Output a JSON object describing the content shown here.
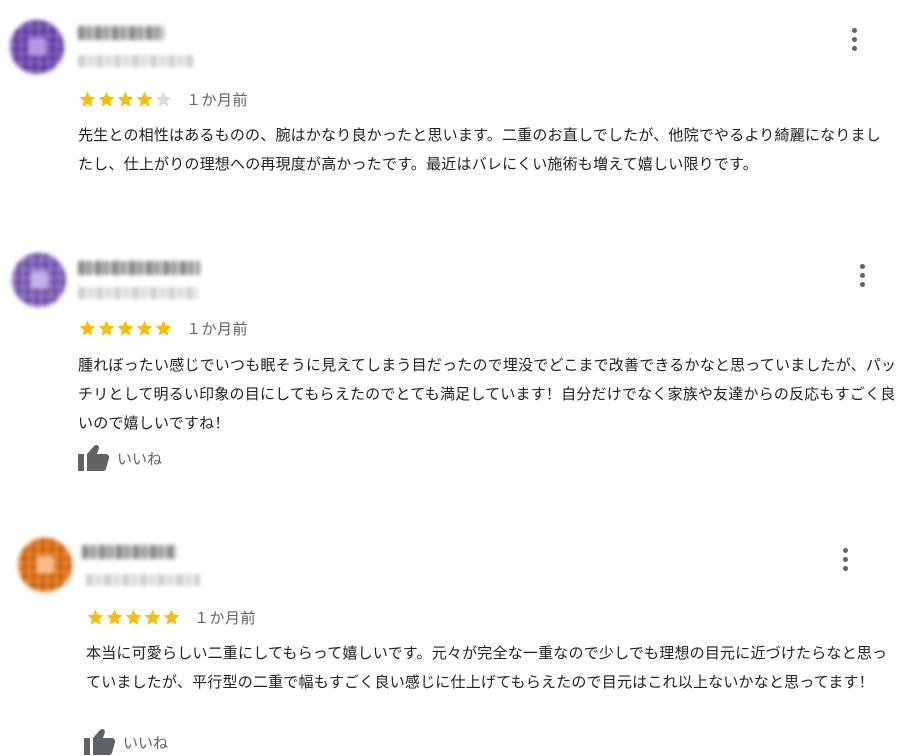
{
  "icons": {
    "more": "more-vertical-icon",
    "star": "star-icon",
    "like": "thumbs-up-icon"
  },
  "colors": {
    "star_filled": "#FBBC04",
    "star_empty": "#DADCE0",
    "secondary_text": "#5F6368",
    "body_text": "#202124"
  },
  "reviews": [
    {
      "avatar_color": "#6A3FB8",
      "avatar_inner": "#B39CE6",
      "rating": 4,
      "max_rating": 5,
      "time": "１か月前",
      "text": "先生との相性はあるものの、腕はかなり良かったと思います。二重のお直しでしたが、他院でやるより綺麗になりましたし、仕上がりの理想への再現度が高かったです。最近はバレにくい施術も増えて嬉しい限りです。"
    },
    {
      "avatar_color": "#7E57C2",
      "avatar_inner": "#C4B1E8",
      "rating": 5,
      "max_rating": 5,
      "time": "１か月前",
      "text": "腫れぼったい感じでいつも眠そうに見えてしまう目だったので埋没でどこまで改善できるかなと思っていましたが、パッチリとして明るい印象の目にしてもらえたのでとても満足しています！自分だけでなく家族や友達からの反応もすごく良いので嬉しいですね！",
      "like_label": "いいね"
    },
    {
      "avatar_color": "#EF6C00",
      "avatar_inner": "#F9B98A",
      "rating": 5,
      "max_rating": 5,
      "time": "１か月前",
      "text": "本当に可愛らしい二重にしてもらって嬉しいです。元々が完全な一重なので少しでも理想の目元に近づけたらなと思っていましたが、平行型の二重で幅もすごく良い感じに仕上げてもらえたので目元はこれ以上ないかなと思ってます！",
      "like_label": "いいね"
    }
  ]
}
